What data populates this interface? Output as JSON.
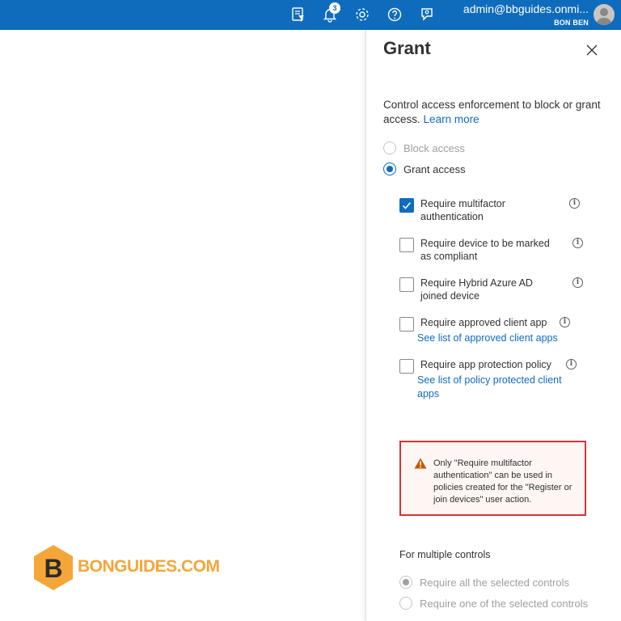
{
  "header": {
    "notification_count": "3",
    "account_email": "admin@bbguides.onmi...",
    "account_name": "BON BEN"
  },
  "panel": {
    "title": "Grant",
    "description": "Control access enforcement to block or grant access.",
    "learn_more": "Learn more",
    "radios": {
      "block": "Block access",
      "grant": "Grant access"
    },
    "checkboxes": [
      {
        "label": "Require multifactor authentication",
        "checked": true
      },
      {
        "label": "Require device to be marked as compliant",
        "checked": false
      },
      {
        "label": "Require Hybrid Azure AD joined device",
        "checked": false
      },
      {
        "label": "Require approved client app",
        "checked": false,
        "link": "See list of approved client apps"
      },
      {
        "label": "Require app protection policy",
        "checked": false,
        "link": "See list of policy protected client apps"
      }
    ],
    "warning": "Only \"Require multifactor authentication\" can be used in policies created for the \"Register or join devices\" user action.",
    "multiple_controls": {
      "label": "For multiple controls",
      "require_all": "Require all the selected controls",
      "require_one": "Require one of the selected controls"
    }
  },
  "watermark": {
    "letter": "B",
    "text": "BONGUIDES.COM"
  },
  "colors": {
    "topbar": "#0f6cbd",
    "accent": "#0f6cbd",
    "warning_border": "#d13438",
    "warning_icon": "#c15b00",
    "watermark": "#f5a638"
  }
}
